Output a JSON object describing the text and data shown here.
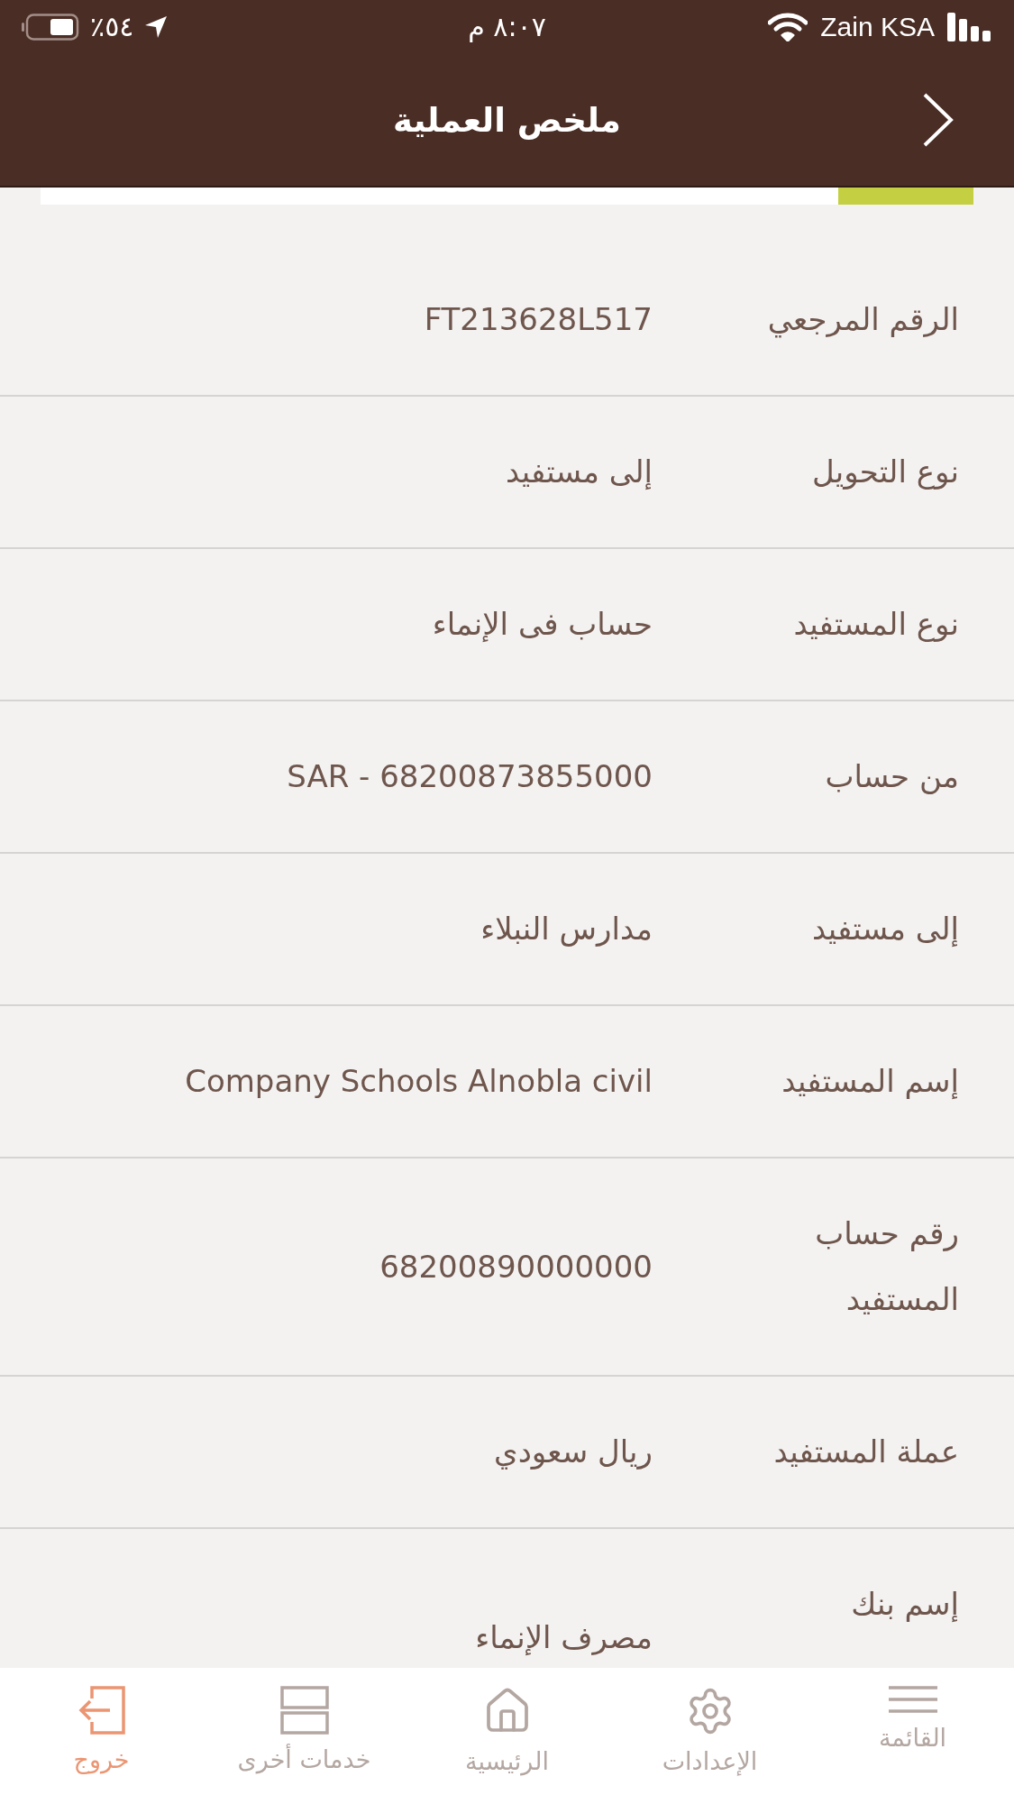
{
  "status_bar": {
    "battery": "٥٤٪",
    "time": "٨:٠٧ م",
    "carrier": "Zain KSA"
  },
  "header": {
    "title": "ملخص العملية"
  },
  "progress": {
    "level": 0.145
  },
  "details": [
    {
      "label": "الرقم المرجعي",
      "value": "FT213628L517"
    },
    {
      "label": "نوع التحويل",
      "value": "إلى مستفيد"
    },
    {
      "label": "نوع المستفيد",
      "value": "حساب فى الإنماء"
    },
    {
      "label": "من حساب",
      "value": "SAR - 68200873855000"
    },
    {
      "label": "إلى مستفيد",
      "value": "مدارس النبلاء"
    },
    {
      "label": "إسم المستفيد",
      "value": "Company Schools Alnobla civil"
    },
    {
      "label": "رقم حساب المستفيد",
      "value": "68200890000000"
    },
    {
      "label": "عملة المستفيد",
      "value": "ريال سعودي"
    },
    {
      "label": "إسم بنك",
      "value": "مصرف الإنماء"
    }
  ],
  "tab_bar": [
    {
      "label": "القائمة",
      "selected": false
    },
    {
      "label": "الإعدادات",
      "selected": false
    },
    {
      "label": "الرئيسية",
      "selected": false
    },
    {
      "label": "خدمات أخرى",
      "selected": false
    },
    {
      "label": "خروج",
      "selected": true
    }
  ]
}
